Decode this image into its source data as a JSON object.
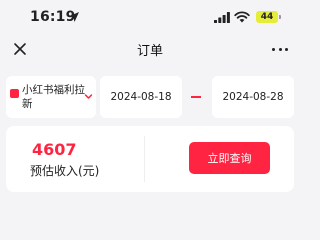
{
  "status_bar": {
    "time": "16:19",
    "battery": "44",
    "icons": [
      "location-arrow-icon",
      "signal-icon",
      "wifi-icon",
      "battery-icon"
    ]
  },
  "nav": {
    "title": "订单",
    "close_icon": "close-icon",
    "more_icon": "more-icon"
  },
  "filter": {
    "platform": "小红书福利拉新",
    "platform_icon": "chevron-down-icon",
    "start_date": "2024-08-18",
    "end_date": "2024-08-28"
  },
  "summary": {
    "income_value": "4607",
    "income_label": "预估收入(元)",
    "query_button": "立即查询"
  },
  "colors": {
    "accent": "#ff2442",
    "background": "#f4f4f6",
    "battery": "#e6ec3a"
  }
}
